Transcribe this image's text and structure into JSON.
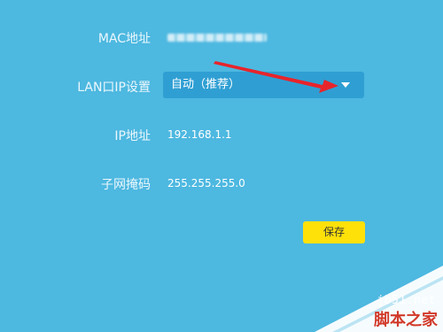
{
  "form": {
    "mac": {
      "label": "MAC地址"
    },
    "lan_ip_setting": {
      "label": "LAN口IP设置",
      "selected": "自动（推荐）"
    },
    "ip": {
      "label": "IP地址",
      "value": "192.168.1.1"
    },
    "subnet": {
      "label": "子网掩码",
      "value": "255.255.255.0"
    },
    "save_label": "保存"
  },
  "watermark": {
    "site": "jb51.net",
    "name": "脚本之家"
  },
  "colors": {
    "background": "#4db8e0",
    "select": "#2f9fd3",
    "save_button": "#ffe10a",
    "arrow": "#e8242b"
  }
}
